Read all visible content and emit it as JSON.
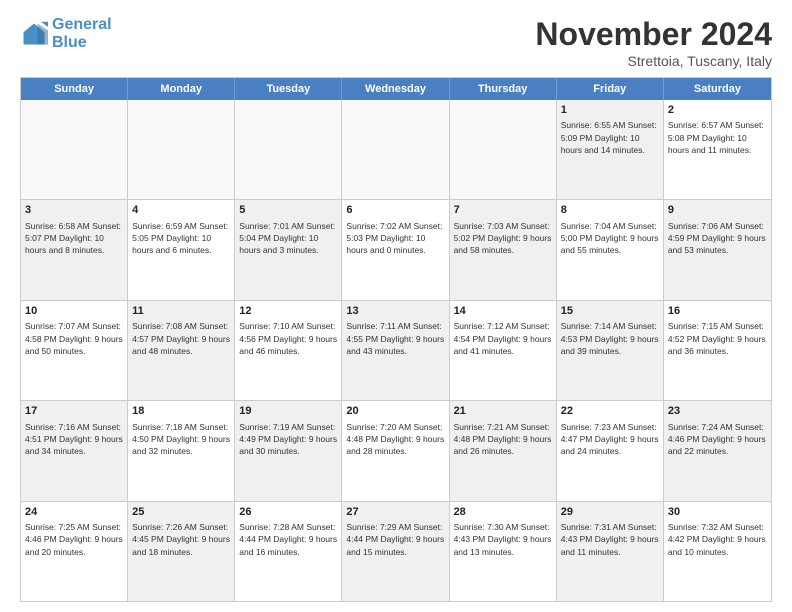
{
  "logo": {
    "line1": "General",
    "line2": "Blue"
  },
  "title": "November 2024",
  "location": "Strettoia, Tuscany, Italy",
  "header_days": [
    "Sunday",
    "Monday",
    "Tuesday",
    "Wednesday",
    "Thursday",
    "Friday",
    "Saturday"
  ],
  "rows": [
    [
      {
        "day": "",
        "text": "",
        "empty": true
      },
      {
        "day": "",
        "text": "",
        "empty": true
      },
      {
        "day": "",
        "text": "",
        "empty": true
      },
      {
        "day": "",
        "text": "",
        "empty": true
      },
      {
        "day": "",
        "text": "",
        "empty": true
      },
      {
        "day": "1",
        "text": "Sunrise: 6:55 AM\nSunset: 5:09 PM\nDaylight: 10 hours and 14 minutes.",
        "shaded": true
      },
      {
        "day": "2",
        "text": "Sunrise: 6:57 AM\nSunset: 5:08 PM\nDaylight: 10 hours and 11 minutes.",
        "shaded": false
      }
    ],
    [
      {
        "day": "3",
        "text": "Sunrise: 6:58 AM\nSunset: 5:07 PM\nDaylight: 10 hours and 8 minutes.",
        "shaded": true
      },
      {
        "day": "4",
        "text": "Sunrise: 6:59 AM\nSunset: 5:05 PM\nDaylight: 10 hours and 6 minutes.",
        "shaded": false
      },
      {
        "day": "5",
        "text": "Sunrise: 7:01 AM\nSunset: 5:04 PM\nDaylight: 10 hours and 3 minutes.",
        "shaded": true
      },
      {
        "day": "6",
        "text": "Sunrise: 7:02 AM\nSunset: 5:03 PM\nDaylight: 10 hours and 0 minutes.",
        "shaded": false
      },
      {
        "day": "7",
        "text": "Sunrise: 7:03 AM\nSunset: 5:02 PM\nDaylight: 9 hours and 58 minutes.",
        "shaded": true
      },
      {
        "day": "8",
        "text": "Sunrise: 7:04 AM\nSunset: 5:00 PM\nDaylight: 9 hours and 55 minutes.",
        "shaded": false
      },
      {
        "day": "9",
        "text": "Sunrise: 7:06 AM\nSunset: 4:59 PM\nDaylight: 9 hours and 53 minutes.",
        "shaded": true
      }
    ],
    [
      {
        "day": "10",
        "text": "Sunrise: 7:07 AM\nSunset: 4:58 PM\nDaylight: 9 hours and 50 minutes.",
        "shaded": false
      },
      {
        "day": "11",
        "text": "Sunrise: 7:08 AM\nSunset: 4:57 PM\nDaylight: 9 hours and 48 minutes.",
        "shaded": true
      },
      {
        "day": "12",
        "text": "Sunrise: 7:10 AM\nSunset: 4:56 PM\nDaylight: 9 hours and 46 minutes.",
        "shaded": false
      },
      {
        "day": "13",
        "text": "Sunrise: 7:11 AM\nSunset: 4:55 PM\nDaylight: 9 hours and 43 minutes.",
        "shaded": true
      },
      {
        "day": "14",
        "text": "Sunrise: 7:12 AM\nSunset: 4:54 PM\nDaylight: 9 hours and 41 minutes.",
        "shaded": false
      },
      {
        "day": "15",
        "text": "Sunrise: 7:14 AM\nSunset: 4:53 PM\nDaylight: 9 hours and 39 minutes.",
        "shaded": true
      },
      {
        "day": "16",
        "text": "Sunrise: 7:15 AM\nSunset: 4:52 PM\nDaylight: 9 hours and 36 minutes.",
        "shaded": false
      }
    ],
    [
      {
        "day": "17",
        "text": "Sunrise: 7:16 AM\nSunset: 4:51 PM\nDaylight: 9 hours and 34 minutes.",
        "shaded": true
      },
      {
        "day": "18",
        "text": "Sunrise: 7:18 AM\nSunset: 4:50 PM\nDaylight: 9 hours and 32 minutes.",
        "shaded": false
      },
      {
        "day": "19",
        "text": "Sunrise: 7:19 AM\nSunset: 4:49 PM\nDaylight: 9 hours and 30 minutes.",
        "shaded": true
      },
      {
        "day": "20",
        "text": "Sunrise: 7:20 AM\nSunset: 4:48 PM\nDaylight: 9 hours and 28 minutes.",
        "shaded": false
      },
      {
        "day": "21",
        "text": "Sunrise: 7:21 AM\nSunset: 4:48 PM\nDaylight: 9 hours and 26 minutes.",
        "shaded": true
      },
      {
        "day": "22",
        "text": "Sunrise: 7:23 AM\nSunset: 4:47 PM\nDaylight: 9 hours and 24 minutes.",
        "shaded": false
      },
      {
        "day": "23",
        "text": "Sunrise: 7:24 AM\nSunset: 4:46 PM\nDaylight: 9 hours and 22 minutes.",
        "shaded": true
      }
    ],
    [
      {
        "day": "24",
        "text": "Sunrise: 7:25 AM\nSunset: 4:46 PM\nDaylight: 9 hours and 20 minutes.",
        "shaded": false
      },
      {
        "day": "25",
        "text": "Sunrise: 7:26 AM\nSunset: 4:45 PM\nDaylight: 9 hours and 18 minutes.",
        "shaded": true
      },
      {
        "day": "26",
        "text": "Sunrise: 7:28 AM\nSunset: 4:44 PM\nDaylight: 9 hours and 16 minutes.",
        "shaded": false
      },
      {
        "day": "27",
        "text": "Sunrise: 7:29 AM\nSunset: 4:44 PM\nDaylight: 9 hours and 15 minutes.",
        "shaded": true
      },
      {
        "day": "28",
        "text": "Sunrise: 7:30 AM\nSunset: 4:43 PM\nDaylight: 9 hours and 13 minutes.",
        "shaded": false
      },
      {
        "day": "29",
        "text": "Sunrise: 7:31 AM\nSunset: 4:43 PM\nDaylight: 9 hours and 11 minutes.",
        "shaded": true
      },
      {
        "day": "30",
        "text": "Sunrise: 7:32 AM\nSunset: 4:42 PM\nDaylight: 9 hours and 10 minutes.",
        "shaded": false
      }
    ]
  ]
}
